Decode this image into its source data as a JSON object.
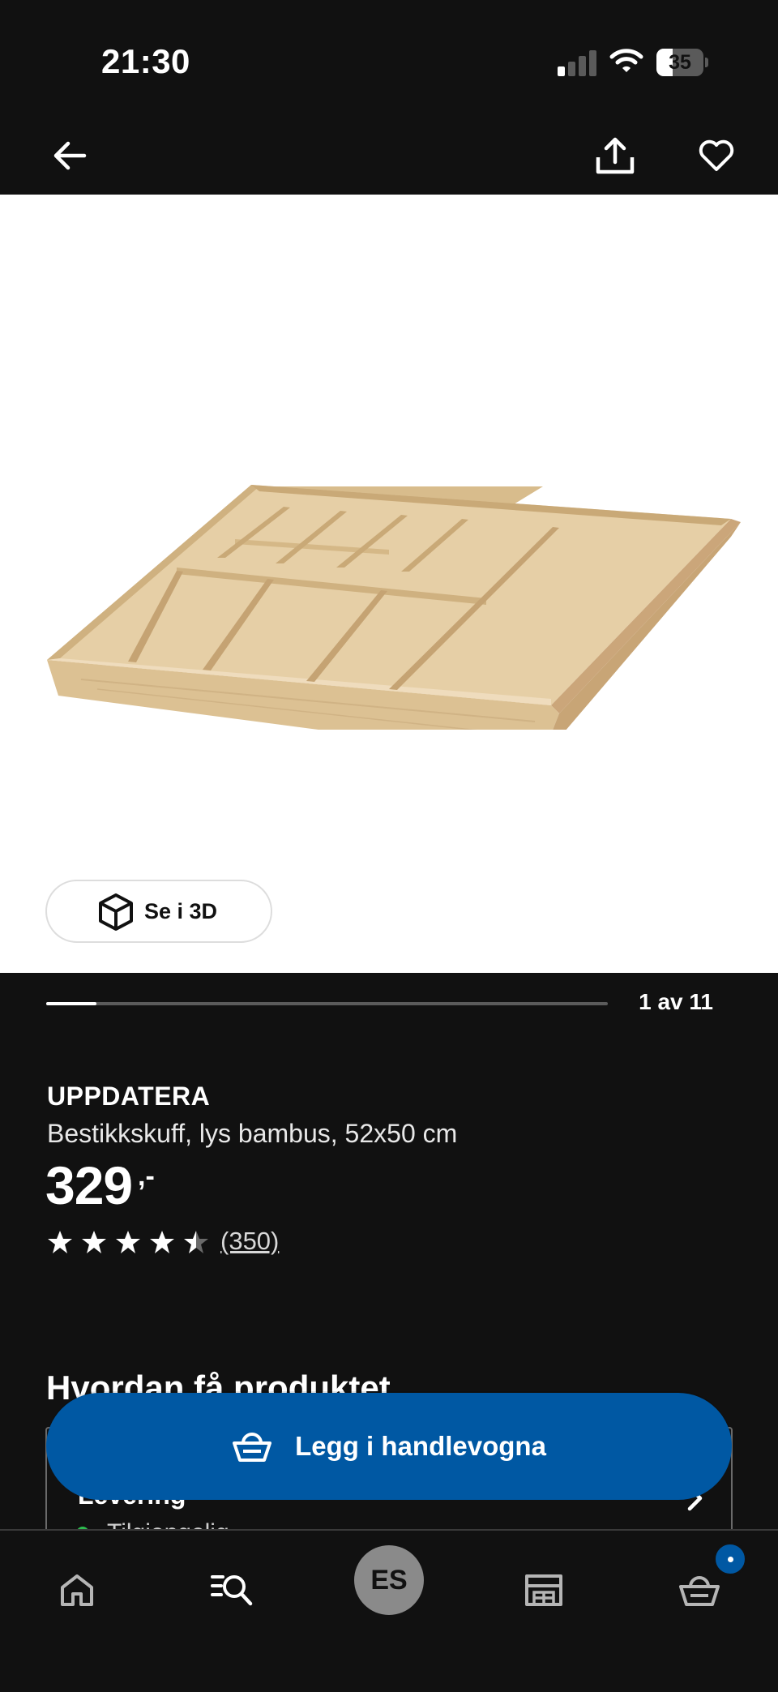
{
  "status_bar": {
    "time": "21:30",
    "battery_level": "35",
    "signal_bars_on": 1,
    "signal_bars_total": 4
  },
  "top_nav": {
    "back_icon": "arrow-left-icon",
    "share_icon": "share-icon",
    "favorite_icon": "heart-icon"
  },
  "gallery": {
    "view_3d_label": "Se i 3D",
    "current_index": 1,
    "total": 11,
    "counter_text": "1 av 11",
    "progress_fraction": 0.09
  },
  "product": {
    "name": "UPPDATERA",
    "description": "Bestikkskuff, lys bambus, 52x50 cm",
    "price": "329",
    "price_suffix": ",-",
    "rating": 4.5,
    "rating_max": 5,
    "review_count": "(350)"
  },
  "delivery": {
    "section_title": "Hvordan få produktet",
    "option_title": "Levering",
    "availability": "Tilgjengelig"
  },
  "cart_button": {
    "label": "Legg i handlevogna"
  },
  "tab_bar": {
    "items": [
      "home-icon",
      "search-list-icon",
      "profile-avatar",
      "store-icon",
      "basket-icon"
    ],
    "avatar_initials": "ES"
  },
  "colors": {
    "background": "#111111",
    "accent_blue": "#0058a3",
    "available_green": "#2dbd4f",
    "wood": "#e2c9a0"
  }
}
